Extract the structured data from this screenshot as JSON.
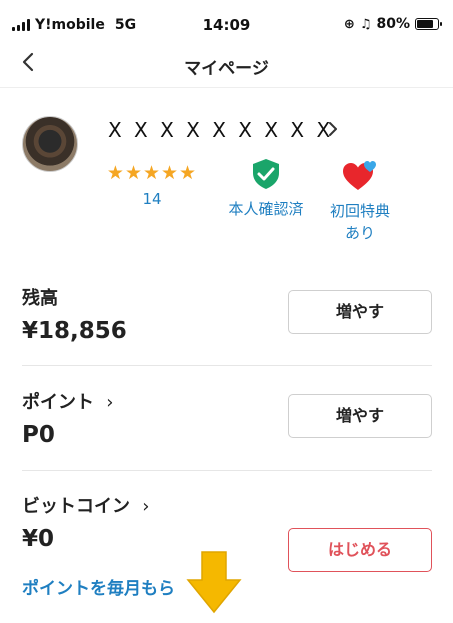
{
  "status_bar": {
    "carrier": "Y!mobile",
    "network": "5G",
    "time": "14:09",
    "battery": "80%",
    "battery_level": 0.8
  },
  "nav": {
    "title": "マイページ"
  },
  "profile": {
    "name": "X X X X X X X X X",
    "rating_stars": 5,
    "rating_count": "14",
    "verified_label": "本人確認済",
    "benefit_label_line1": "初回特典",
    "benefit_label_line2": "あり"
  },
  "balance": {
    "label": "残高",
    "value": "¥18,856",
    "button": "増やす"
  },
  "points": {
    "label": "ポイント",
    "value": "P0",
    "button": "増やす"
  },
  "bitcoin": {
    "label": "ビットコイン",
    "value": "¥0",
    "button": "はじめる"
  },
  "promo": {
    "text": "ポイントを毎月もら"
  },
  "colors": {
    "link_blue": "#1f7fc1",
    "star_orange": "#f5a623",
    "accent_red": "#e0525a",
    "verify_green": "#1aa56a",
    "overlay_arrow": "#f5b800"
  }
}
